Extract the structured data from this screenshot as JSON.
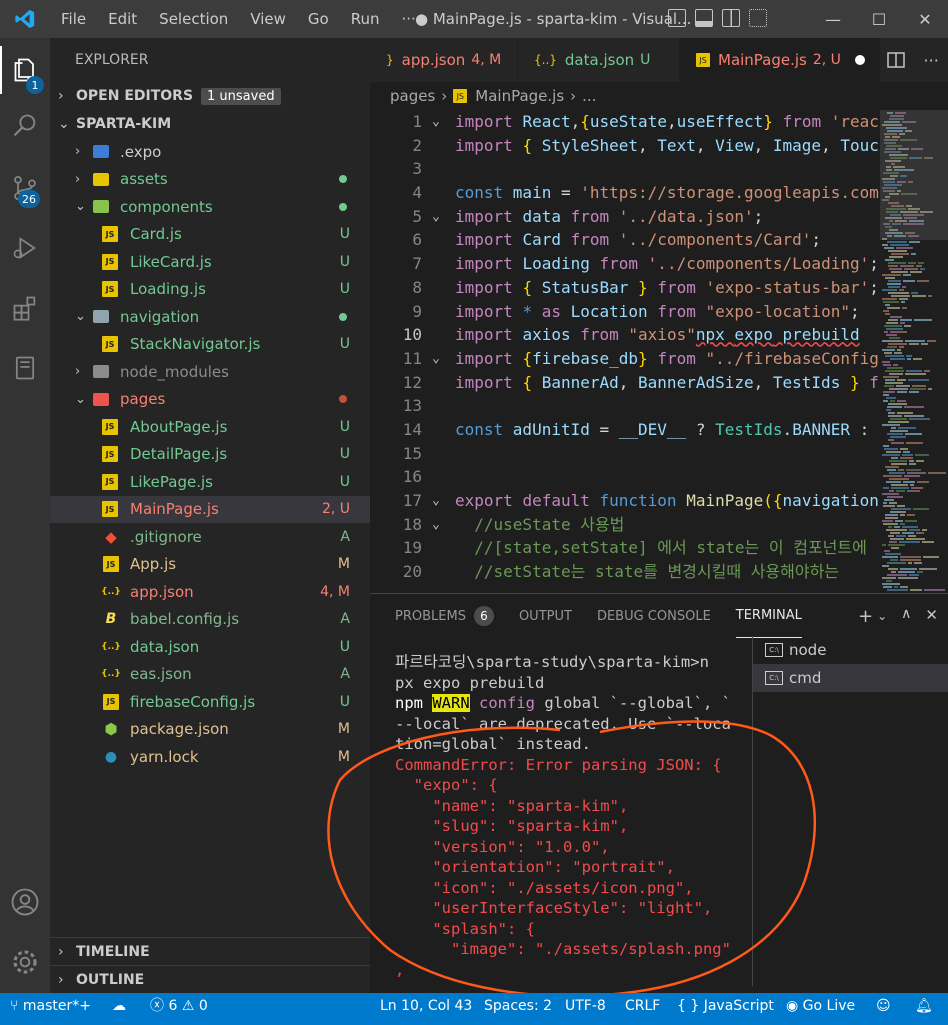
{
  "titlebar": {
    "menu": [
      "File",
      "Edit",
      "Selection",
      "View",
      "Go",
      "Run",
      "···"
    ],
    "title": "● MainPage.js - sparta-kim - Visual...",
    "win": [
      "—",
      "☐",
      "✕"
    ]
  },
  "activity": {
    "explorer_badge": "1",
    "scm_badge": "26"
  },
  "sidebar": {
    "header": "EXPLORER",
    "open_editors": "OPEN EDITORS",
    "unsaved": "1 unsaved",
    "project": "SPARTA-KIM",
    "timeline": "TIMELINE",
    "outline": "OUTLINE",
    "tree": [
      {
        "name": ".expo",
        "depth": 0,
        "type": "folder",
        "chev": "›",
        "color": "#cccccc",
        "status": "",
        "dot": ""
      },
      {
        "name": "assets",
        "depth": 0,
        "type": "folder",
        "chev": "›",
        "color": "#73c991",
        "status": "",
        "dot": "#73c991"
      },
      {
        "name": "components",
        "depth": 0,
        "type": "folder",
        "chev": "⌄",
        "color": "#73c991",
        "status": "",
        "dot": "#73c991"
      },
      {
        "name": "Card.js",
        "depth": 1,
        "type": "js",
        "color": "#73c991",
        "status": "U",
        "statusColor": "#73c991"
      },
      {
        "name": "LikeCard.js",
        "depth": 1,
        "type": "js",
        "color": "#73c991",
        "status": "U",
        "statusColor": "#73c991"
      },
      {
        "name": "Loading.js",
        "depth": 1,
        "type": "js",
        "color": "#73c991",
        "status": "U",
        "statusColor": "#73c991"
      },
      {
        "name": "navigation",
        "depth": 0,
        "type": "folder",
        "chev": "⌄",
        "color": "#73c991",
        "status": "",
        "dot": "#73c991"
      },
      {
        "name": "StackNavigator.js",
        "depth": 1,
        "type": "js",
        "color": "#73c991",
        "status": "U",
        "statusColor": "#73c991"
      },
      {
        "name": "node_modules",
        "depth": 0,
        "type": "folder",
        "chev": "›",
        "color": "#8c8c8c",
        "status": "",
        "dot": ""
      },
      {
        "name": "pages",
        "depth": 0,
        "type": "folder",
        "chev": "⌄",
        "color": "#f88070",
        "status": "",
        "dot": "#c74e39"
      },
      {
        "name": "AboutPage.js",
        "depth": 1,
        "type": "js",
        "color": "#73c991",
        "status": "U",
        "statusColor": "#73c991"
      },
      {
        "name": "DetailPage.js",
        "depth": 1,
        "type": "js",
        "color": "#73c991",
        "status": "U",
        "statusColor": "#73c991"
      },
      {
        "name": "LikePage.js",
        "depth": 1,
        "type": "js",
        "color": "#73c991",
        "status": "U",
        "statusColor": "#73c991"
      },
      {
        "name": "MainPage.js",
        "depth": 1,
        "type": "js",
        "color": "#f88070",
        "status": "2, U",
        "statusColor": "#f88070",
        "selected": true
      },
      {
        "name": ".gitignore",
        "depth": 0,
        "type": "git",
        "color": "#81b88b",
        "status": "A",
        "statusColor": "#81b88b"
      },
      {
        "name": "App.js",
        "depth": 0,
        "type": "js",
        "color": "#e2c08d",
        "status": "M",
        "statusColor": "#e2c08d"
      },
      {
        "name": "app.json",
        "depth": 0,
        "type": "json",
        "color": "#f88070",
        "status": "4, M",
        "statusColor": "#f88070"
      },
      {
        "name": "babel.config.js",
        "depth": 0,
        "type": "babel",
        "color": "#81b88b",
        "status": "A",
        "statusColor": "#81b88b"
      },
      {
        "name": "data.json",
        "depth": 0,
        "type": "json",
        "color": "#73c991",
        "status": "U",
        "statusColor": "#73c991"
      },
      {
        "name": "eas.json",
        "depth": 0,
        "type": "json",
        "color": "#81b88b",
        "status": "A",
        "statusColor": "#81b88b"
      },
      {
        "name": "firebaseConfig.js",
        "depth": 0,
        "type": "js",
        "color": "#73c991",
        "status": "U",
        "statusColor": "#73c991"
      },
      {
        "name": "package.json",
        "depth": 0,
        "type": "node",
        "color": "#e2c08d",
        "status": "M",
        "statusColor": "#e2c08d"
      },
      {
        "name": "yarn.lock",
        "depth": 0,
        "type": "yarn",
        "color": "#e2c08d",
        "status": "M",
        "statusColor": "#e2c08d"
      }
    ]
  },
  "editor": {
    "tabs": [
      {
        "name": "app.json",
        "suffix": "4, M",
        "color": "#f88070",
        "icon": "}"
      },
      {
        "name": "data.json",
        "suffix": "U",
        "color": "#73c991",
        "icon": "{..}"
      },
      {
        "name": "MainPage.js",
        "suffix": "2, U",
        "color": "#f88070",
        "icon": "JS",
        "active": true
      }
    ],
    "breadcrumb": {
      "folder": "pages",
      "file": "MainPage.js",
      "more": "..."
    },
    "current_line": "10",
    "lines": [
      {
        "n": "1",
        "fold": "⌄",
        "parts": [
          [
            "kc",
            "import "
          ],
          [
            "v",
            "React"
          ],
          [
            "w",
            ","
          ],
          [
            "y",
            "{"
          ],
          [
            "v",
            "useState"
          ],
          [
            "w",
            ","
          ],
          [
            "v",
            "useEffect"
          ],
          [
            "y",
            "}"
          ],
          [
            "kc",
            " from "
          ],
          [
            "s",
            "'reac"
          ]
        ]
      },
      {
        "n": "2",
        "parts": [
          [
            "kc",
            "import "
          ],
          [
            "y",
            "{ "
          ],
          [
            "v",
            "StyleSheet"
          ],
          [
            "w",
            ", "
          ],
          [
            "v",
            "Text"
          ],
          [
            "w",
            ", "
          ],
          [
            "v",
            "View"
          ],
          [
            "w",
            ", "
          ],
          [
            "v",
            "Image"
          ],
          [
            "w",
            ", "
          ],
          [
            "v",
            "Touc"
          ]
        ]
      },
      {
        "n": "3",
        "parts": []
      },
      {
        "n": "4",
        "parts": [
          [
            "k",
            "const "
          ],
          [
            "v",
            "main"
          ],
          [
            "w",
            " = "
          ],
          [
            "s",
            "'https://storage.googleapis.com"
          ]
        ]
      },
      {
        "n": "5",
        "fold": "⌄",
        "parts": [
          [
            "kc",
            "import "
          ],
          [
            "v",
            "data"
          ],
          [
            "kc",
            " from "
          ],
          [
            "s",
            "'../data.json'"
          ],
          [
            "w",
            ";"
          ]
        ]
      },
      {
        "n": "6",
        "parts": [
          [
            "kc",
            "import "
          ],
          [
            "v",
            "Card"
          ],
          [
            "kc",
            " from "
          ],
          [
            "s",
            "'../components/Card'"
          ],
          [
            "w",
            ";"
          ]
        ]
      },
      {
        "n": "7",
        "parts": [
          [
            "kc",
            "import "
          ],
          [
            "v",
            "Loading"
          ],
          [
            "kc",
            " from "
          ],
          [
            "s",
            "'../components/Loading'"
          ],
          [
            "w",
            ";"
          ]
        ]
      },
      {
        "n": "8",
        "parts": [
          [
            "kc",
            "import "
          ],
          [
            "y",
            "{ "
          ],
          [
            "v",
            "StatusBar"
          ],
          [
            "y",
            " }"
          ],
          [
            "kc",
            " from "
          ],
          [
            "s",
            "'expo-status-bar'"
          ],
          [
            "w",
            ";"
          ]
        ]
      },
      {
        "n": "9",
        "parts": [
          [
            "kc",
            "import "
          ],
          [
            "k",
            "* "
          ],
          [
            "kc",
            "as "
          ],
          [
            "v",
            "Location"
          ],
          [
            "kc",
            " from "
          ],
          [
            "s",
            "\"expo-location\""
          ],
          [
            "w",
            ";"
          ]
        ]
      },
      {
        "n": "10",
        "parts": [
          [
            "kc",
            "import "
          ],
          [
            "v",
            "axios"
          ],
          [
            "kc",
            " from "
          ],
          [
            "s",
            "\"axios\""
          ],
          [
            "v",
            "npx "
          ],
          [
            "v",
            "expo"
          ],
          [
            "v",
            " prebuild"
          ]
        ]
      },
      {
        "n": "11",
        "fold": "⌄",
        "parts": [
          [
            "kc",
            "import "
          ],
          [
            "y",
            "{"
          ],
          [
            "v",
            "firebase_db"
          ],
          [
            "y",
            "}"
          ],
          [
            "kc",
            " from "
          ],
          [
            "s",
            "\"../firebaseConfig"
          ]
        ]
      },
      {
        "n": "12",
        "parts": [
          [
            "kc",
            "import "
          ],
          [
            "y",
            "{ "
          ],
          [
            "v",
            "BannerAd"
          ],
          [
            "w",
            ", "
          ],
          [
            "v",
            "BannerAdSize"
          ],
          [
            "w",
            ", "
          ],
          [
            "v",
            "TestIds"
          ],
          [
            "y",
            " }"
          ],
          [
            "kc",
            " f"
          ]
        ]
      },
      {
        "n": "13",
        "parts": []
      },
      {
        "n": "14",
        "parts": [
          [
            "k",
            "const "
          ],
          [
            "v",
            "adUnitId"
          ],
          [
            "w",
            " = "
          ],
          [
            "v",
            "__DEV__"
          ],
          [
            "w",
            " ? "
          ],
          [
            "t",
            "TestIds"
          ],
          [
            "w",
            "."
          ],
          [
            "v",
            "BANNER"
          ],
          [
            "w",
            " :"
          ]
        ]
      },
      {
        "n": "15",
        "parts": []
      },
      {
        "n": "16",
        "parts": []
      },
      {
        "n": "17",
        "fold": "⌄",
        "parts": [
          [
            "kc",
            "export "
          ],
          [
            "kc",
            "default "
          ],
          [
            "k",
            "function "
          ],
          [
            "f",
            "MainPage"
          ],
          [
            "y",
            "("
          ],
          [
            "y",
            "{"
          ],
          [
            "v",
            "navigation"
          ]
        ]
      },
      {
        "n": "18",
        "fold": "⌄",
        "parts": [
          [
            "c",
            "  //useState 사용법"
          ]
        ]
      },
      {
        "n": "19",
        "parts": [
          [
            "c",
            "  //[state,setState] 에서 state는 이 컴포넌트에"
          ]
        ]
      },
      {
        "n": "20",
        "parts": [
          [
            "c",
            "  //setState는 state를 변경시킬때 사용해야하는"
          ]
        ]
      }
    ]
  },
  "panel": {
    "tabs": [
      "PROBLEMS",
      "OUTPUT",
      "DEBUG CONSOLE",
      "TERMINAL"
    ],
    "problems_count": "6",
    "terminals": [
      "node",
      "cmd"
    ],
    "term_lines": [
      {
        "cls": "",
        "text": "파르타코딩\\sparta-study\\sparta-kim>n"
      },
      {
        "cls": "",
        "text": "px expo prebuild"
      },
      {
        "cls": "npm",
        "text": "npm WARN config global `--global`, `"
      },
      {
        "cls": "",
        "text": "--local` are deprecated. Use `--loca"
      },
      {
        "cls": "",
        "text": "tion=global` instead."
      },
      {
        "cls": "",
        "text": ""
      },
      {
        "cls": "err",
        "text": "CommandError: Error parsing JSON: {"
      },
      {
        "cls": "err",
        "text": "  \"expo\": {"
      },
      {
        "cls": "err",
        "text": "    \"name\": \"sparta-kim\","
      },
      {
        "cls": "err",
        "text": "    \"slug\": \"sparta-kim\","
      },
      {
        "cls": "err",
        "text": "    \"version\": \"1.0.0\","
      },
      {
        "cls": "err",
        "text": "    \"orientation\": \"portrait\","
      },
      {
        "cls": "err",
        "text": "    \"icon\": \"./assets/icon.png\","
      },
      {
        "cls": "err",
        "text": "    \"userInterfaceStyle\": \"light\","
      },
      {
        "cls": "err",
        "text": "    \"splash\": {"
      },
      {
        "cls": "err",
        "text": "      \"image\": \"./assets/splash.png\""
      },
      {
        "cls": "err",
        "text": ","
      }
    ]
  },
  "statusbar": {
    "branch": "master*+",
    "errors": "6",
    "warnings": "0",
    "position": "Ln 10, Col 43",
    "spaces": "Spaces: 2",
    "encoding": "UTF-8",
    "eol": "CRLF",
    "language": "JavaScript",
    "golive": "Go Live"
  }
}
